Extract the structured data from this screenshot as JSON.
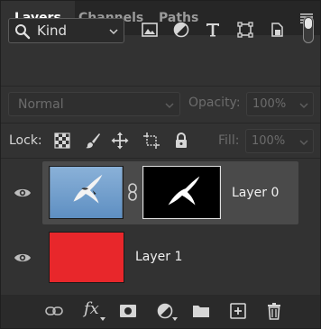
{
  "tabs": [
    {
      "label": "Layers",
      "active": true
    },
    {
      "label": "Channels",
      "active": false
    },
    {
      "label": "Paths",
      "active": false
    }
  ],
  "filter": {
    "kind_label": "Kind",
    "icons": [
      "image-filter-icon",
      "adjustment-filter-icon",
      "type-filter-icon",
      "shape-filter-icon",
      "smart-object-filter-icon"
    ],
    "toggle_on": true
  },
  "blend": {
    "mode": "Normal",
    "opacity_label": "Opacity:",
    "opacity_value": "100%",
    "enabled": false
  },
  "lock": {
    "label": "Lock:",
    "icons": [
      "lock-transparent-pixels-icon",
      "lock-image-pixels-icon",
      "lock-position-icon",
      "lock-artboard-icon",
      "lock-all-icon"
    ],
    "fill_label": "Fill:",
    "fill_value": "100%"
  },
  "layers": [
    {
      "name": "Layer 0",
      "visible": true,
      "selected": true,
      "has_mask": true,
      "linked": true
    },
    {
      "name": "Layer 1",
      "visible": true,
      "selected": false,
      "fill_color": "#e8272b"
    }
  ],
  "footer_icons": [
    "link-layers-icon",
    "fx-icon",
    "add-mask-icon",
    "adjustment-layer-icon",
    "group-folder-icon",
    "new-layer-icon",
    "delete-icon"
  ],
  "footer": {
    "fx_label": "fx"
  },
  "colors": {
    "panel_bg": "#323232",
    "tab_bar_bg": "#262626",
    "selected_row": "#4a4a4a",
    "layer1_fill": "#e8272b",
    "thumb_sky": "#6f9dcc"
  }
}
